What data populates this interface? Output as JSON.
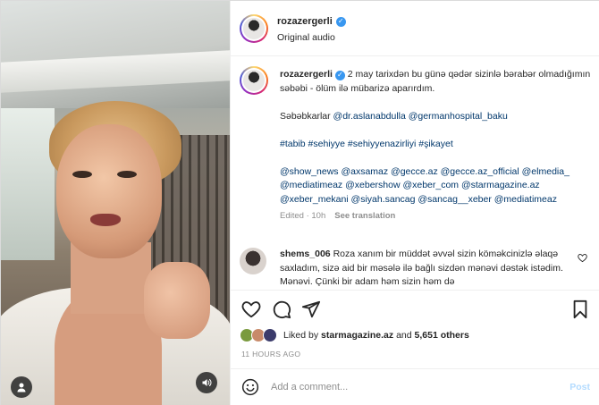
{
  "post": {
    "username": "rozazergerli",
    "subtitle": "Original audio"
  },
  "caption": {
    "username": "rozazergerli",
    "line1": "2 may tarixdən bu günə qədər sizinlə bərabər olmadığımın səbəbi - ölüm ilə mübarizə aparırdım.",
    "line2_prefix": "Səbəbkarlar",
    "line2_mentions": "@dr.aslanabdulla @germanhospital_baku",
    "hashtags": "#tabib #sehiyye #sehiyyenazirliyi #şikayet",
    "mentions_block": "@show_news @axsamaz @gecce.az @gecce.az_official @elmedia_ @mediatimeaz @xebershow @xeber_com @starmagazine.az @xeber_mekani @siyah.sancag @sancag__xeber @mediatimeaz",
    "edited": "Edited · 10h",
    "see_translation": "See translation"
  },
  "comment": {
    "username": "shems_006",
    "text": "Roza xanım bir müddət əvvəl sizin köməkcinizlə əlaqə saxladım, sizə aid bir məsələ ilə bağlı sizdən mənəvi dəstək istədim. Mənəvi. Çünki bir adam həm sizin həm də"
  },
  "likes": {
    "prefix": "Liked by",
    "user": "starmagazine.az",
    "and": "and",
    "count": "5,651 others"
  },
  "timestamp": "11 HOURS AGO",
  "add_comment": {
    "placeholder": "Add a comment...",
    "post_label": "Post"
  },
  "colors": {
    "verified": "#3897f0",
    "mention": "#00376b",
    "muted": "#8e8e8e",
    "post_disabled": "#b3dbff"
  },
  "icons": {
    "header_verified": "verified-icon",
    "like": "heart-icon",
    "comment": "comment-icon",
    "share": "share-icon",
    "save": "bookmark-icon",
    "emoji": "emoji-icon",
    "audio": "speaker-icon",
    "profile": "user-icon"
  }
}
